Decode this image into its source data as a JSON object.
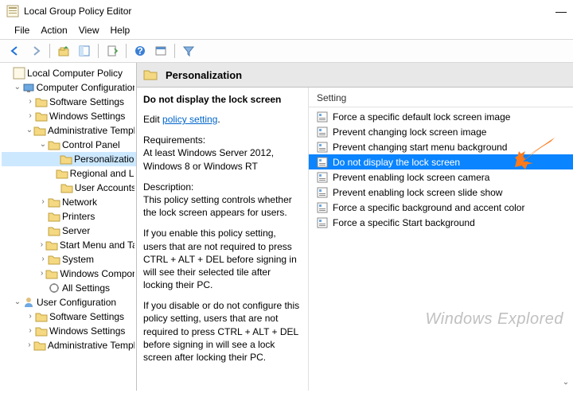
{
  "window": {
    "title": "Local Group Policy Editor",
    "minimize": "—"
  },
  "menu": {
    "file": "File",
    "action": "Action",
    "view": "View",
    "help": "Help"
  },
  "tree": {
    "root": "Local Computer Policy",
    "cc": "Computer Configuration",
    "ss1": "Software Settings",
    "ws1": "Windows Settings",
    "at1": "Administrative Templates",
    "cp": "Control Panel",
    "perso": "Personalization",
    "reg": "Regional and Language Options",
    "ua": "User Accounts",
    "net": "Network",
    "prn": "Printers",
    "srv": "Server",
    "sm": "Start Menu and Taskbar",
    "sys": "System",
    "wc": "Windows Components",
    "als": "All Settings",
    "uc": "User Configuration",
    "ss2": "Software Settings",
    "ws2": "Windows Settings",
    "at2": "Administrative Templates"
  },
  "header": {
    "title": "Personalization"
  },
  "desc": {
    "title": "Do not display the lock screen",
    "edit": "Edit ",
    "link": "policy setting",
    "req_label": "Requirements:",
    "req_text": "At least Windows Server 2012, Windows 8 or Windows RT",
    "desc_label": "Description:",
    "desc_text": "This policy setting controls whether the lock screen appears for users.",
    "p2": "If you enable this policy setting, users that are not required to press CTRL + ALT + DEL before signing in will see their selected tile after locking their PC.",
    "p3": "If you disable or do not configure this policy setting, users that are not required to press CTRL + ALT + DEL before signing in will see a lock screen after locking their PC."
  },
  "list": {
    "col": "Setting",
    "items": [
      "Force a specific default lock screen image",
      "Prevent changing lock screen image",
      "Prevent changing start menu background",
      "Do not display the lock screen",
      "Prevent enabling lock screen camera",
      "Prevent enabling lock screen slide show",
      "Force a specific background and accent color",
      "Force a specific Start background"
    ]
  },
  "watermark": "Windows Explored"
}
